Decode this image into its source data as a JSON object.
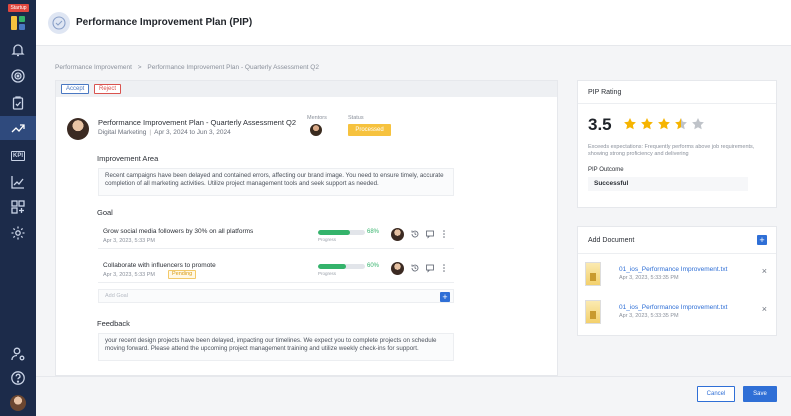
{
  "sidebar": {
    "badge": "Startup",
    "logo_colors": [
      "#f6c23e",
      "#34b36b",
      "#4a78c2",
      "#e0473f"
    ]
  },
  "header": {
    "title": "Performance Improvement Plan (PIP)"
  },
  "breadcrumb": {
    "root": "Performance Improvement",
    "separator": ">",
    "current": "Performance Improvement Plan - Quarterly Assessment Q2"
  },
  "toolbar": {
    "accept_label": "Accept",
    "reject_label": "Reject"
  },
  "plan": {
    "title": "Performance Improvement Plan - Quarterly Assessment Q2",
    "department": "Digital Marketing",
    "dates": "Apr 3, 2024 to Jun 3, 2024",
    "mentors_label": "Mentors",
    "status_label": "Status",
    "status": "Processed"
  },
  "improvement": {
    "heading": "Improvement Area",
    "text": "Recent campaigns have been delayed and contained errors, affecting our brand image. You need to ensure timely, accurate completion of all marketing activities. Utilize project management tools and seek support as needed."
  },
  "goals": {
    "heading": "Goal",
    "items": [
      {
        "title": "Grow social media followers by 30% on all platforms",
        "date": "Apr 3, 2023, 5:33 PM",
        "tag": "",
        "progress": 68,
        "progress_text": "68%",
        "bar_label": "Progress"
      },
      {
        "title": "Collaborate with influencers to promote",
        "date": "Apr 3, 2023, 5:33 PM",
        "tag": "Pending",
        "progress": 60,
        "progress_text": "60%",
        "bar_label": "Progress"
      }
    ],
    "add_placeholder": "Add Goal"
  },
  "feedback": {
    "heading": "Feedback",
    "text": "your recent design projects have been delayed, impacting our timelines. We expect you to complete projects on schedule moving forward. Please attend the upcoming project management training and utilize weekly check-ins for support."
  },
  "rating": {
    "heading": "PIP Rating",
    "score": "3.5",
    "stars": 3.5,
    "max_stars": 5,
    "star_color": "#f6b400",
    "description": "Exceeds expectations: Frequently performs above job requirements, showing strong proficiency and delivering",
    "outcome_label": "PIP Outcome",
    "outcome": "Successful"
  },
  "documents": {
    "heading": "Add Document",
    "items": [
      {
        "name": "01_ios_Performance Improvement.txt",
        "date": "Apr 3, 2023, 5:33:35 PM"
      },
      {
        "name": "01_ios_Performance Improvement.txt",
        "date": "Apr 3, 2023, 5:33:35 PM"
      }
    ]
  },
  "footer": {
    "cancel_label": "Cancel",
    "save_label": "Save"
  }
}
